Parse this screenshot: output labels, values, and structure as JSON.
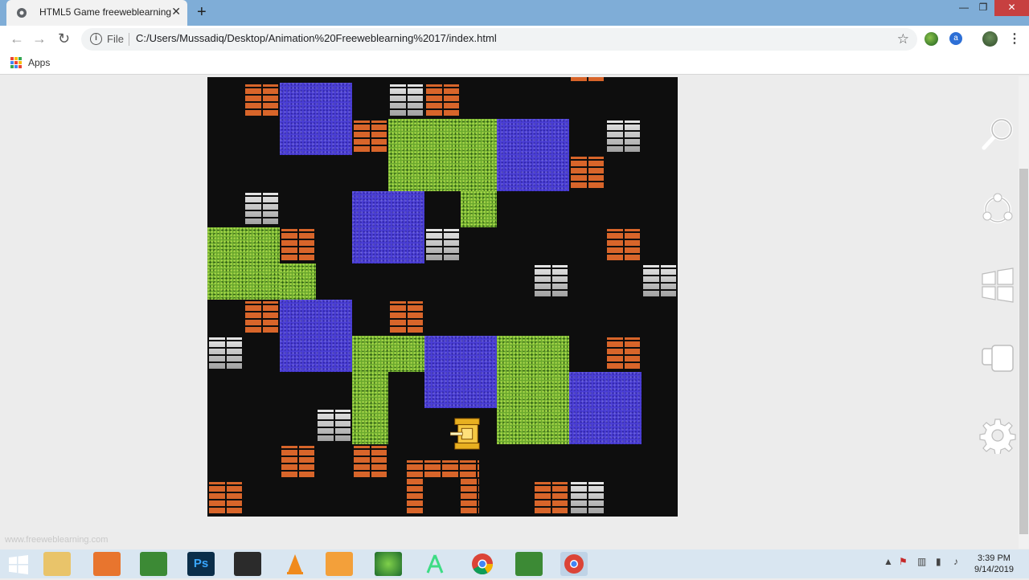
{
  "browser": {
    "tab_title": "HTML5 Game freeweblearning",
    "tab_close": "✕",
    "new_tab": "+",
    "file_label": "File",
    "url": "C:/Users/Mussadiq/Desktop/Animation%20Freeweblearning%2017/index.html",
    "info_icon": "i",
    "star_icon": "☆",
    "menu_icon": "⋮",
    "ext2_label": "a",
    "bookmarks_apps": "Apps",
    "window_min": "—",
    "window_max": "❐",
    "window_close": "✕",
    "nav_back": "←",
    "nav_forward": "→",
    "nav_reload": "↻"
  },
  "page": {
    "watermark": "www.freeweblearning.com"
  },
  "taskbar": {
    "time": "3:39 PM",
    "date": "9/14/2019",
    "tray_up": "▲"
  },
  "game": {
    "grid_cell": "45px",
    "colors": {
      "background": "#0e0e0e",
      "brick": "#d8652a",
      "steel": "#c8c8c8",
      "water": "#4b3fd6",
      "grass": "#6dab2e",
      "tank": "#e8b020"
    },
    "player_tank": {
      "col": 6.7,
      "row": 9.4
    }
  }
}
